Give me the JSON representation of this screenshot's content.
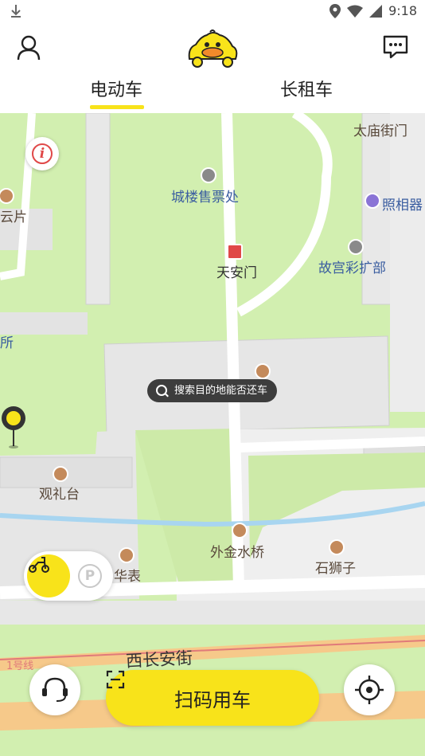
{
  "status_bar": {
    "time": "9:18",
    "icons": [
      "download-icon",
      "location-icon",
      "wifi-icon",
      "signal-icon"
    ]
  },
  "header": {
    "profile_icon": "person-icon",
    "logo": "duck-car-logo",
    "message_icon": "chat-icon",
    "tabs": [
      {
        "label": "电动车",
        "active": true
      },
      {
        "label": "长租车",
        "active": false
      }
    ],
    "accent_color": "#f8e31a"
  },
  "map": {
    "pois": [
      {
        "label": "太庙街门"
      },
      {
        "label": "城楼售票处"
      },
      {
        "label": "照相器"
      },
      {
        "label": "云片"
      },
      {
        "label": "天安门"
      },
      {
        "label": "故宫彩扩部"
      },
      {
        "label": "所"
      },
      {
        "label": "观礼台"
      },
      {
        "label": "外金水桥"
      },
      {
        "label": "石狮子"
      },
      {
        "label": "华表"
      },
      {
        "label": "西长安街"
      },
      {
        "label": "1号线"
      }
    ],
    "tooltip": "搜索目的地能否还车",
    "info_icon": "info-icon"
  },
  "controls": {
    "mode_scooter_icon": "scooter-icon",
    "mode_parking_label": "P",
    "service_icon": "headset-icon",
    "scan_icon": "scan-frame-icon",
    "scan_label": "扫码用车",
    "locate_icon": "crosshair-icon"
  }
}
